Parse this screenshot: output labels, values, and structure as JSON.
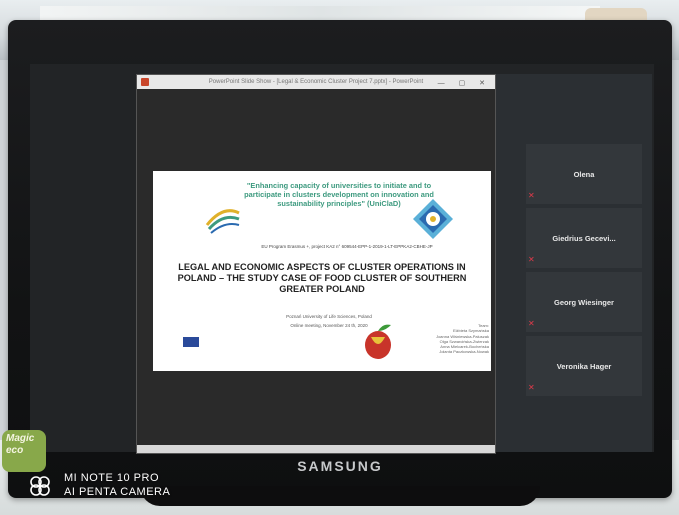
{
  "slide_window": {
    "title": "PowerPoint Slide Show - [Legal & Economic Cluster Project 7.pptx] - PowerPoint"
  },
  "slide": {
    "tagline": "\"Enhancing capacity of universities to initiate and to participate in clusters development on innovation and sustainability principles\" (UniClaD)",
    "project_id": "EU Program Erasmus +, project KA2 n° 609544-EPP-1-2019-1-LT-EPPKA2-CBHE-JP",
    "main_title": "LEGAL AND ECONOMIC ASPECTS OF CLUSTER OPERATIONS IN POLAND – THE STUDY CASE OF FOOD CLUSTER OF SOUTHERN GREATER POLAND",
    "university": "Poznań University of Life Sciences, Poland",
    "meeting": "Online meeting, November 24 th, 2020",
    "authors": [
      "Team:",
      "Elżbieta Szymańska",
      "Joanna Wiśniewska-Paluszak",
      "Olga Szwarcińska-Zwierzak",
      "Anna Mielcarek-Bocheńska",
      "Jolanta Paczkowska-Nowak"
    ]
  },
  "participants": [
    {
      "name": "Olena"
    },
    {
      "name": "Giedrius Gecevi..."
    },
    {
      "name": "Georg Wiesinger"
    },
    {
      "name": "Veronika Hager"
    }
  ],
  "monitor": {
    "brand": "SAMSUNG"
  },
  "sticker": {
    "text": "Magic eco"
  },
  "camera_watermark": {
    "line1": "MI NOTE 10 PRO",
    "line2": "AI PENTA CAMERA"
  },
  "colors": {
    "tagline": "#3d9a7f",
    "mic_muted": "#e03a4a",
    "bezel": "#121314"
  }
}
